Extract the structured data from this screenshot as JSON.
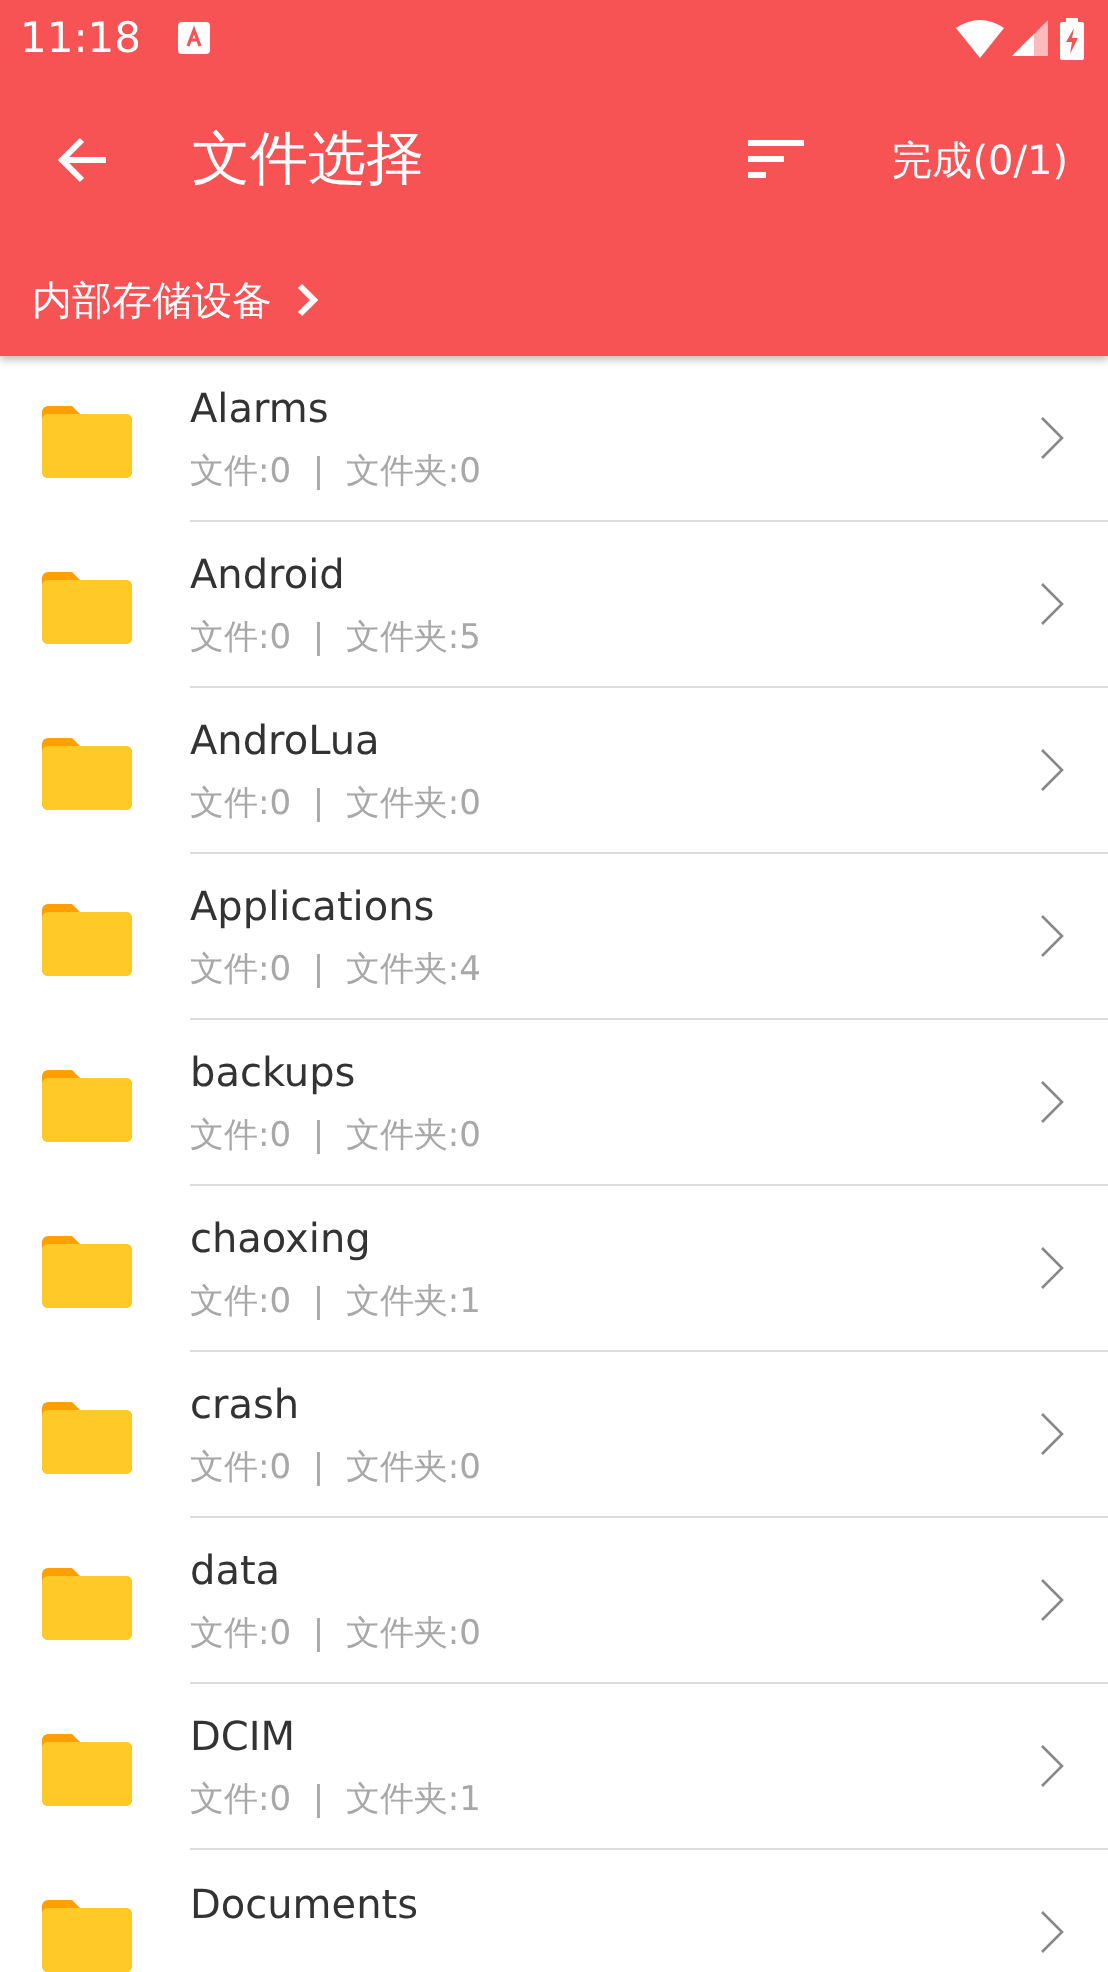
{
  "status_bar": {
    "time": "11:18"
  },
  "toolbar": {
    "title": "文件选择",
    "done_button": "完成(0/1)"
  },
  "breadcrumb": {
    "path": "内部存储设备"
  },
  "folders": [
    {
      "name": "Alarms",
      "info": "文件:0  |  文件夹:0"
    },
    {
      "name": "Android",
      "info": "文件:0  |  文件夹:5"
    },
    {
      "name": "AndroLua",
      "info": "文件:0  |  文件夹:0"
    },
    {
      "name": "Applications",
      "info": "文件:0  |  文件夹:4"
    },
    {
      "name": "backups",
      "info": "文件:0  |  文件夹:0"
    },
    {
      "name": "chaoxing",
      "info": "文件:0  |  文件夹:1"
    },
    {
      "name": "crash",
      "info": "文件:0  |  文件夹:0"
    },
    {
      "name": "data",
      "info": "文件:0  |  文件夹:0"
    },
    {
      "name": "DCIM",
      "info": "文件:0  |  文件夹:1"
    },
    {
      "name": "Documents"
    }
  ]
}
